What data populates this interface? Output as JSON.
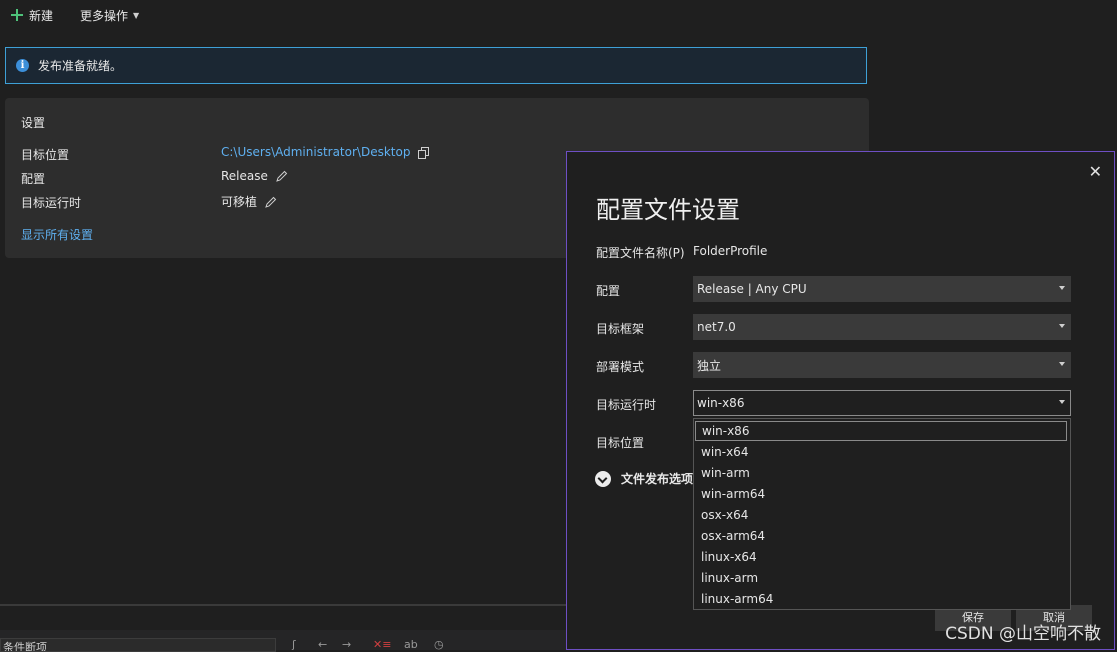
{
  "toolbar": {
    "new_label": "新建",
    "more_actions_label": "更多操作"
  },
  "banner": {
    "message": "发布准备就绪。"
  },
  "settings": {
    "title": "设置",
    "target_location_label": "目标位置",
    "target_location_value": "C:\\Users\\Administrator\\Desktop",
    "configuration_label": "配置",
    "configuration_value": "Release",
    "target_runtime_label": "目标运行时",
    "target_runtime_value": "可移植",
    "show_all_link": "显示所有设置"
  },
  "bottom": {
    "combo_text": "条件断项"
  },
  "dialog": {
    "title": "配置文件设置",
    "profile_name_label": "配置文件名称(P)",
    "profile_name_value": "FolderProfile",
    "configuration_label": "配置",
    "configuration_value": "Release | Any CPU",
    "target_framework_label": "目标框架",
    "target_framework_value": "net7.0",
    "deployment_mode_label": "部署模式",
    "deployment_mode_value": "独立",
    "target_runtime_label": "目标运行时",
    "target_runtime_value": "win-x86",
    "target_location_label": "目标位置",
    "file_publish_options_label": "文件发布选项",
    "save_label": "保存",
    "cancel_label": "取消",
    "runtime_options": [
      "win-x86",
      "win-x64",
      "win-arm",
      "win-arm64",
      "osx-x64",
      "osx-arm64",
      "linux-x64",
      "linux-arm",
      "linux-arm64"
    ],
    "selected_runtime_option": "win-x86"
  },
  "watermark": "CSDN @山空响不散",
  "colors": {
    "accent_link": "#5fb0f0",
    "dialog_border": "#6e4fc4",
    "banner_border": "#3ea0d6",
    "add_icon": "#4ec27a"
  }
}
